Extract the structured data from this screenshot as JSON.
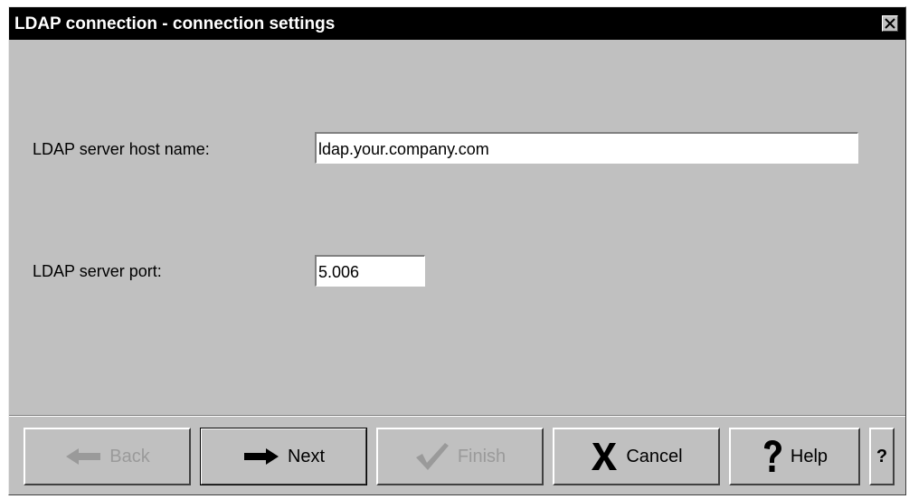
{
  "window": {
    "title": "LDAP connection - connection settings",
    "close_glyph": "✕"
  },
  "form": {
    "host_label": "LDAP server host name:",
    "host_value": "ldap.your.company.com",
    "port_label": "LDAP server port:",
    "port_value": "5.006"
  },
  "buttons": {
    "back": "Back",
    "next": "Next",
    "finish": "Finish",
    "cancel": "Cancel",
    "help": "Help",
    "whats_this": "?"
  },
  "icons": {
    "back": "arrow-left-icon",
    "next": "arrow-right-icon",
    "finish": "checkmark-icon",
    "cancel": "x-icon",
    "help": "question-mark-icon"
  },
  "colors": {
    "dialog_bg": "#c0c0c0",
    "titlebar_bg": "#000000",
    "disabled_text": "#9a9a9a"
  }
}
